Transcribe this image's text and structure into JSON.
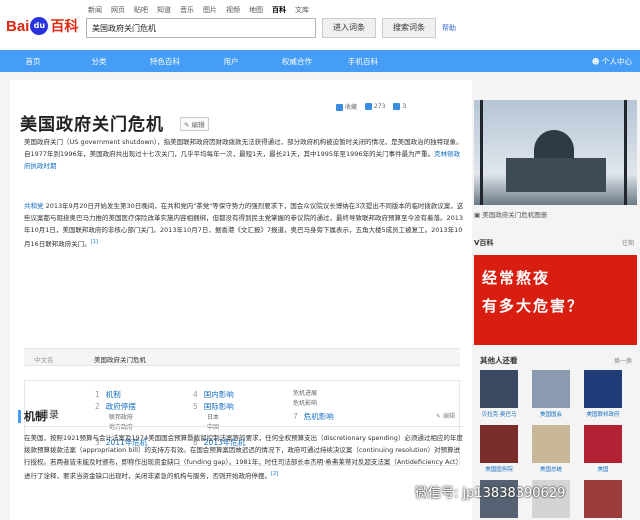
{
  "header": {
    "logo_bai": "Bai",
    "logo_du": "du",
    "logo_baike": "百科",
    "channels": [
      "新闻",
      "网页",
      "贴吧",
      "知道",
      "音乐",
      "图片",
      "视频",
      "地图",
      "百科",
      "文库"
    ],
    "active_channel": "百科",
    "search_value": "美国政府关门危机",
    "enter_button": "进入词条",
    "search_button": "搜索词条",
    "help": "帮助"
  },
  "nav": {
    "items": [
      "首页",
      "分类",
      "特色百科",
      "用户",
      "权威合作",
      "手机百科"
    ],
    "user": "个人中心"
  },
  "article": {
    "title": "美国政府关门危机",
    "edit_label": "编辑",
    "actions": {
      "favorite": "收藏",
      "like_count": "273",
      "share_count": "3"
    },
    "intro": "美国政府关门（US government shutdown），指美国联邦政府因财政拨款无法获得通过，部分政府机构被迫暂时关闭的情况，是美国政治的独特现象。自1977年到1996年，美国政府共出现过十七次关门，几乎平均每年一次，最短1天，最长21天，其中1995年至1996年的关门事件最为严重。",
    "intro_link": "克林顿政府执政时期",
    "para2": "2013年9月20日开始发生第30日晚间，在共和党内\"茶党\"等保守势力的强烈要求下，国会众议院议长博纳在3次提出不同版本的临时拨款议案，这些议案都与阻挠奥巴马力推的美国医疗保险改革实施内容相捆绑，但都没有得到民主党掌握的参议院的通过，最终导致联邦政府预算至今没有着落。2013年10月1日，美国联邦政府的非核心部门关门。2013年10月7日，据香港《文汇报》7报道，奥巴马身旁下属表示，五角大楼5成员工被复工。2013年10月16日联邦政府关门。",
    "para2_link": "共和党",
    "basic_key": "中文名",
    "basic_value": "美国政府关门危机",
    "toc_label": "目录",
    "toc": [
      {
        "n": "1",
        "label": "机制"
      },
      {
        "n": "2",
        "label": "政府停摆",
        "subs": [
          "联邦政府",
          "地方政府"
        ]
      },
      {
        "n": "3",
        "label": "2011年危机"
      },
      {
        "n": "4",
        "label": "国内影响"
      },
      {
        "n": "5",
        "label": "国际影响",
        "subs": [
          "日本",
          "中国"
        ]
      },
      {
        "n": "6",
        "label": "2013年危机"
      },
      {
        "n": "7",
        "label": "危机影响",
        "pre": [
          "危机进展",
          "危机影响"
        ]
      }
    ],
    "section_title": "机制",
    "section_edit": "编辑",
    "section_text": "在美国，按照1921预算与会计法案及1974美国国会预算暨截留控制法案等的要求，任何全权预算支出（discretionary spending）必须通过相应的年度拨款预算拨款法案（appropriation bill）的支持方有效。在国会预算案因故迟迟的情况下，政府可通过持续决议案（continuing resolution）对预算进行授权。若两者皆未能及时颁布，即称作出现资金缺口（funding gap）。1981年，时任司法部长本杰明·希弗莱蒂对反超支法案（Antideficiency Act）进行了诠释，要求当资金缺口出现时，关闭非紧急的机构与服务，否则开始政府停摆。"
  },
  "sidebar": {
    "pic_caption": "美国政府关门危机图册",
    "v_keyword": "V百科",
    "v_more": "往期",
    "banner_line1": "经常熬夜",
    "banner_line2": "有多大危害？",
    "people_title": "其他人还看",
    "people_more": "换一换",
    "people": [
      "贝拉克·奥巴马",
      "美国国会",
      "美国联邦政府",
      "美国国务院",
      "美国总统",
      "美国"
    ]
  },
  "watermark": "微信号: jp13838390629",
  "colors": {
    "nav_blue": "#459df5",
    "link_blue": "#136ec2",
    "banner_red": "#d81e10",
    "logo_red": "#de2910"
  }
}
